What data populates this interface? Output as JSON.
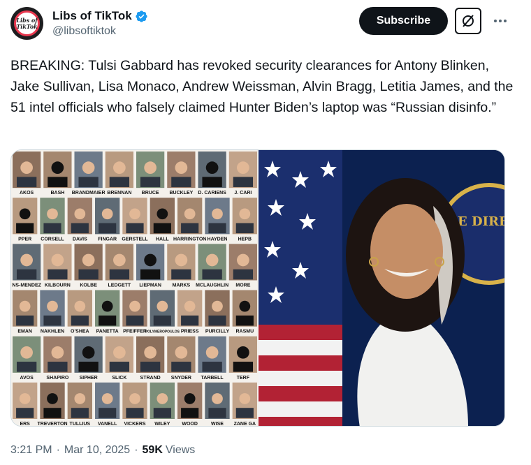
{
  "tweet": {
    "author": {
      "display_name": "Libs of TikTok",
      "handle": "@libsoftiktok",
      "avatar_text": "Libs of TikTok",
      "verified": true
    },
    "subscribe_label": "Subscribe",
    "text": "BREAKING: Tulsi Gabbard has revoked security clearances for Antony Blinken, Jake Sullivan, Lisa Monaco, Andrew Weissman, Alvin Bragg, Letitia James, and the 51 intel officials who falsely claimed Hunter Biden’s laptop was “Russian disinfo.”",
    "time": "3:21 PM",
    "date": "Mar 10, 2025",
    "views_count": "59K",
    "views_label": "Views"
  },
  "media": {
    "collage_names": [
      [
        "AKOS",
        "BASH",
        "BRANDMAIER",
        "BRENNAN",
        "BRUCE",
        "BUCKLEY",
        "D. CARIENS",
        "J. CARI"
      ],
      [
        "PPER",
        "CORSELL",
        "DAVIS",
        "FINGAR",
        "GERSTELL",
        "HALL",
        "HARRINGTON",
        "HAYDEN",
        "HEPB"
      ],
      [
        "NS-MENDEZ",
        "KILBOURN",
        "KOLBE",
        "LEDGETT",
        "LIEPMAN",
        "MARKS",
        "MCLAUGHLIN",
        "MORE"
      ],
      [
        "EMAN",
        "NAKHLEN",
        "O'SHEA",
        "PANETTA",
        "PFEIFFER",
        "POLYMEROPOULOS",
        "PRIESS",
        "PURCILLY",
        "RASMU"
      ],
      [
        "AVOS",
        "SHAPIRO",
        "SIPHER",
        "SLICK",
        "STRAND",
        "SNYDER",
        "TARBELL",
        "TERF"
      ],
      [
        "ERS",
        "TREVERTON",
        "TULLIUS",
        "VANELL",
        "VICKERS",
        "WILEY",
        "WOOD",
        "WISE",
        "ZANE GA"
      ]
    ],
    "seal_text": "E DIRE"
  },
  "colors": {
    "text_primary": "#0f1419",
    "text_secondary": "#536471",
    "verified_blue": "#1d9bf0",
    "subscribe_bg": "#0f1419"
  },
  "icons": {
    "verified": "verified-badge-icon",
    "grok": "grok-icon",
    "more": "more-dots-icon"
  }
}
